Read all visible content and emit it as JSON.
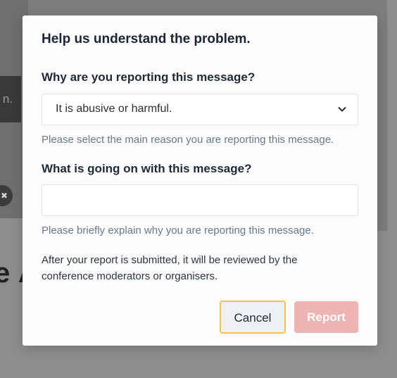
{
  "background": {
    "toast_text": "n.",
    "close_glyph": "✖",
    "heading_fragment": "e A"
  },
  "modal": {
    "title": "Help us understand the problem.",
    "reason": {
      "label": "Why are you reporting this message?",
      "selected": "It is abusive or harmful.",
      "icon": "chevron-down-icon",
      "help": "Please select the main reason you are reporting this message."
    },
    "details": {
      "label": "What is going on with this message?",
      "value": "",
      "help": "Please briefly explain why you are reporting this message."
    },
    "notice": "After your report is submitted, it will be reviewed by the conference moderators or organisers.",
    "buttons": {
      "cancel": "Cancel",
      "report": "Report"
    }
  },
  "colors": {
    "focus_ring": "#f2c744",
    "report_disabled": "#f0b3b3",
    "help_text": "#6b7888"
  }
}
